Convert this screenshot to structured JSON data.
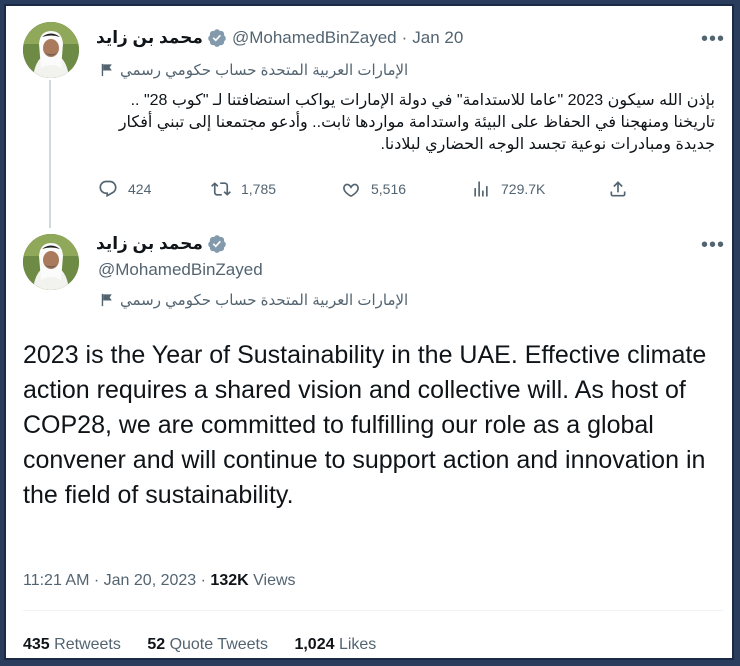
{
  "quoted": {
    "name": "محمد بن زايد",
    "handle": "@MohamedBinZayed",
    "separator": "·",
    "date": "Jan 20",
    "gov_label": "الإمارات العربية المتحدة حساب حكومي رسمي",
    "text": "بإذن الله سيكون 2023 \"عاما للاستدامة\" في دولة الإمارات يواكب استضافتنا لـ \"كوب 28\" .. تاريخنا ومنهجنا في الحفاظ على البيئة واستدامة مواردها ثابت.. وأدعو مجتمعنا إلى تبني أفكار جديدة ومبادرات نوعية تجسد الوجه الحضاري لبلادنا.",
    "replies": "424",
    "retweets": "1,785",
    "likes": "5,516",
    "views": "729.7K"
  },
  "tweet": {
    "name": "محمد بن زايد",
    "handle": "@MohamedBinZayed",
    "gov_label": "الإمارات العربية المتحدة حساب حكومي رسمي",
    "text": "2023 is the Year of Sustainability in the UAE. Effective climate action requires a shared vision and collective will. As host of COP28, we are committed to fulfilling our role as a global convener and will continue to support action and innovation in the field of sustainability.",
    "time": "11:21 AM",
    "separator": "·",
    "date": "Jan 20, 2023",
    "views_count": "132K",
    "views_label": "Views",
    "retweets_count": "435",
    "retweets_label": "Retweets",
    "quotes_count": "52",
    "quotes_label": "Quote Tweets",
    "likes_count": "1,024",
    "likes_label": "Likes"
  },
  "icons": {
    "more": "more-horizontal-icon",
    "verified": "verified-badge-icon",
    "flag": "government-flag-icon",
    "reply": "reply-icon",
    "retweet": "retweet-icon",
    "like": "heart-icon",
    "views": "analytics-bars-icon",
    "share": "share-icon"
  },
  "colors": {
    "verified": "#829aab",
    "secondary_text": "#536471",
    "primary_text": "#0f1419",
    "frame_border": "#1b2a44"
  }
}
